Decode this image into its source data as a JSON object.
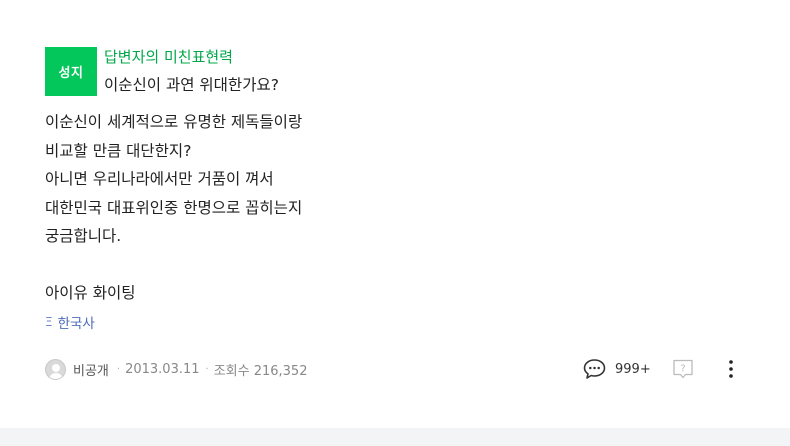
{
  "question": {
    "badge": "성지",
    "author_line": "답변자의 미친표현력",
    "title": "이순신이 과연 위대한가요?",
    "body_lines": [
      "이순신이 세계적으로 유명한 제독들이랑",
      "비교할 만큼 대단한지?",
      "아니면 우리나라에서만 거품이 껴서",
      "대한민국 대표위인중 한명으로 꼽히는지",
      "궁금합니다.",
      "",
      "아이유 화이팅"
    ],
    "tag": "한국사",
    "tag_icon": "hash-tag-icon"
  },
  "meta": {
    "user": "비공개",
    "date": "2013.03.11",
    "views": "조회수 216,352"
  },
  "actions": {
    "comment_count": "999+",
    "help_icon": "question-box-icon",
    "more_icon": "more-vertical-icon"
  },
  "colors": {
    "badge_bg": "#03c75a",
    "author_green": "#00a84a",
    "tag_blue": "#4c6db8"
  }
}
